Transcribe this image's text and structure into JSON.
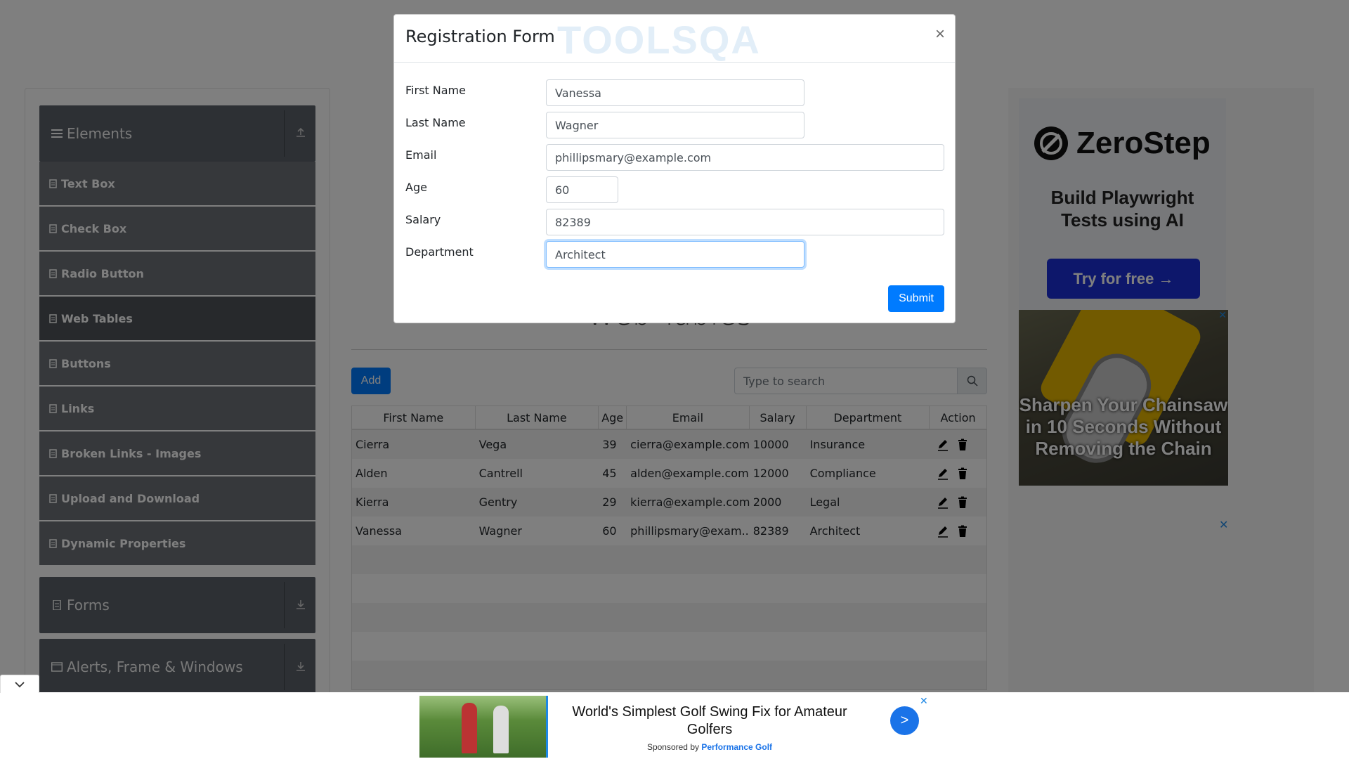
{
  "sidebar": {
    "elements_label": "Elements",
    "items": [
      {
        "label": "Text Box"
      },
      {
        "label": "Check Box"
      },
      {
        "label": "Radio Button"
      },
      {
        "label": "Web Tables"
      },
      {
        "label": "Buttons"
      },
      {
        "label": "Links"
      },
      {
        "label": "Broken Links - Images"
      },
      {
        "label": "Upload and Download"
      },
      {
        "label": "Dynamic Properties"
      }
    ],
    "forms_label": "Forms",
    "alerts_label": "Alerts, Frame & Windows"
  },
  "web_tables": {
    "title": "Web Tables",
    "add_label": "Add",
    "search_placeholder": "Type to search",
    "columns": [
      "First Name",
      "Last Name",
      "Age",
      "Email",
      "Salary",
      "Department",
      "Action"
    ],
    "rows": [
      {
        "first": "Cierra",
        "last": "Vega",
        "age": "39",
        "email": "cierra@example.com",
        "salary": "10000",
        "dept": "Insurance"
      },
      {
        "first": "Alden",
        "last": "Cantrell",
        "age": "45",
        "email": "alden@example.com",
        "salary": "12000",
        "dept": "Compliance"
      },
      {
        "first": "Kierra",
        "last": "Gentry",
        "age": "29",
        "email": "kierra@example.com",
        "salary": "2000",
        "dept": "Legal"
      },
      {
        "first": "Vanessa",
        "last": "Wagner",
        "age": "60",
        "email": "phillipsmary@exam...",
        "salary": "82389",
        "dept": "Architect"
      }
    ]
  },
  "modal": {
    "title": "Registration Form",
    "logo_text": "TOOLSQA",
    "close_label": "×",
    "fields": {
      "first_name": {
        "label": "First Name",
        "value": "Vanessa"
      },
      "last_name": {
        "label": "Last Name",
        "value": "Wagner"
      },
      "email": {
        "label": "Email",
        "value": "phillipsmary@example.com"
      },
      "age": {
        "label": "Age",
        "value": "60"
      },
      "salary": {
        "label": "Salary",
        "value": "82389"
      },
      "department": {
        "label": "Department",
        "value": "Architect"
      }
    },
    "submit_label": "Submit"
  },
  "right_ad": {
    "brand": "ZeroStep",
    "tagline_1": "Build Playwright",
    "tagline_2": "Tests using AI",
    "cta": "Try for free →",
    "saw_text": "Sharpen Your Chainsaw in 10 Seconds Without Removing the Chain"
  },
  "bottom_ad": {
    "headline": "World's Simplest Golf Swing Fix for Amateur Golfers",
    "sponsored_prefix": "Sponsored by",
    "sponsor": "Performance Golf",
    "go_label": ">"
  },
  "colors": {
    "primary": "#007bff",
    "sidebar_header": "#5a6169",
    "zerostep_button": "#1a2fd6"
  }
}
